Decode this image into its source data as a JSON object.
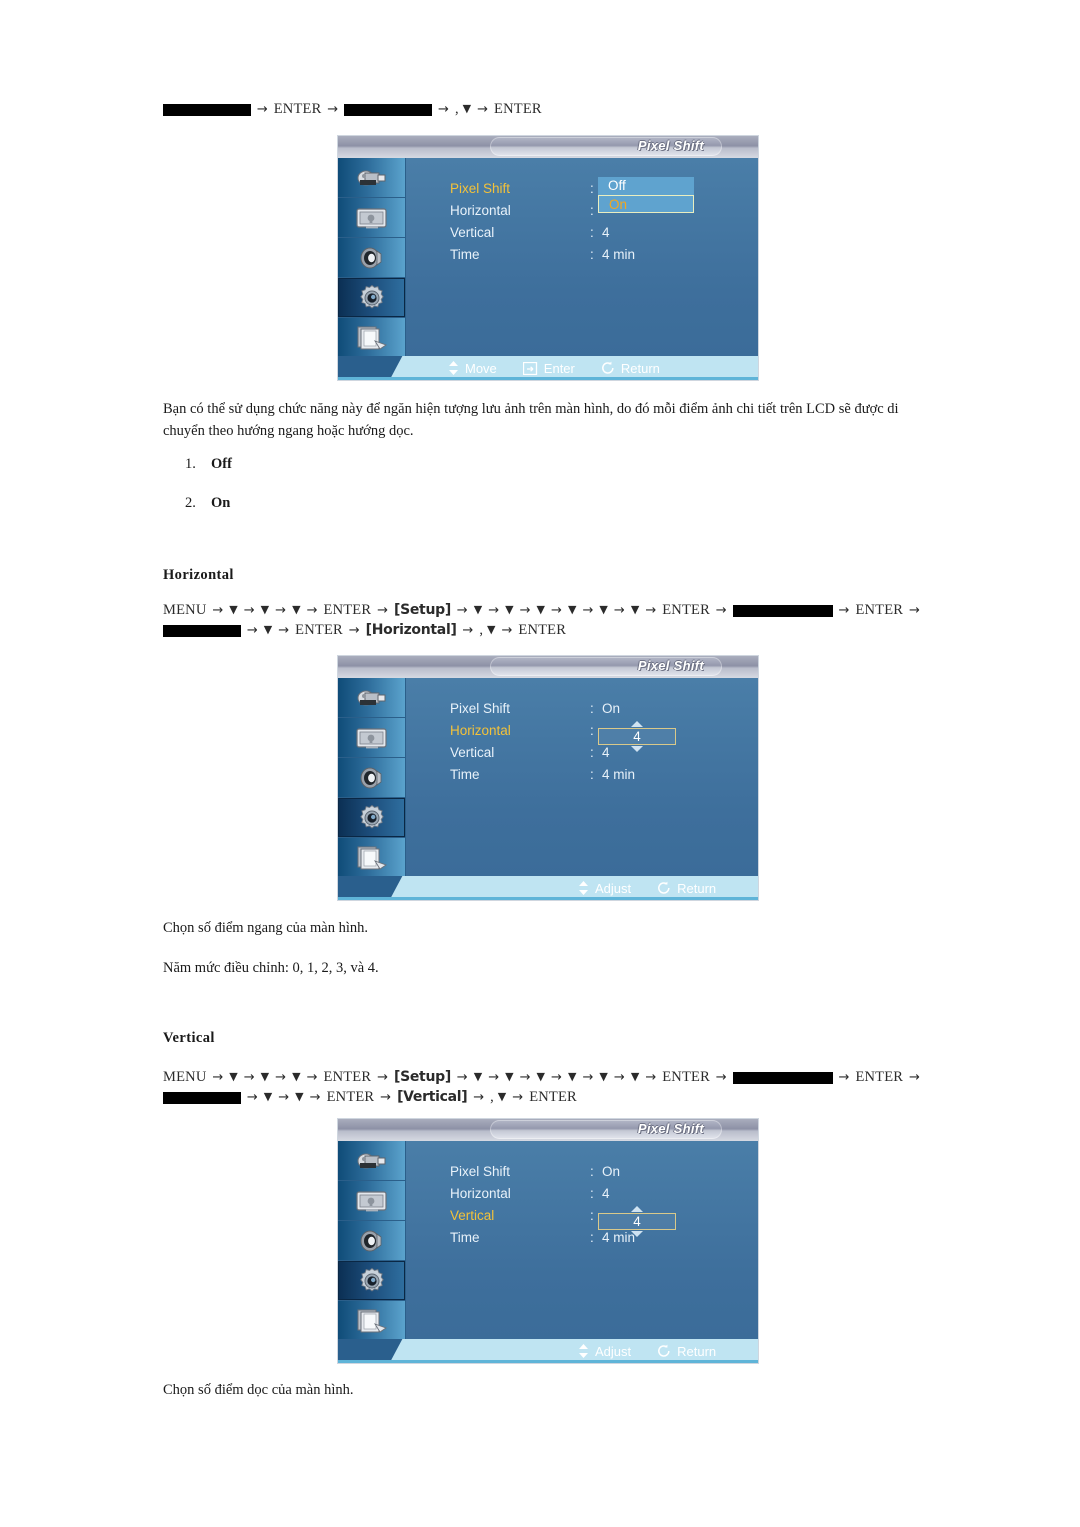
{
  "document": {
    "language": "vi",
    "title_text_color": "#1a1a1a"
  },
  "pixel_shift_section": {
    "navpath": {
      "line1": [
        {
          "type": "blackbox",
          "width": "bb-w2"
        },
        {
          "type": "arrow",
          "text": "→"
        },
        {
          "type": "text",
          "text": "ENTER"
        },
        {
          "type": "arrow",
          "text": "→"
        },
        {
          "type": "blackbox",
          "width": "bb-w2"
        },
        {
          "type": "arrow",
          "text": "→"
        },
        {
          "type": "text",
          "text": ","
        },
        {
          "type": "down",
          "text": "▼"
        },
        {
          "type": "arrow",
          "text": "→"
        },
        {
          "type": "text",
          "text": "ENTER"
        }
      ]
    },
    "osd": {
      "title": "Pixel Shift",
      "rows": [
        {
          "label": "Pixel Shift",
          "colon": ":",
          "value": "",
          "selected": true,
          "control": "dropdown"
        },
        {
          "label": "Horizontal",
          "colon": ":",
          "value": "",
          "selected": false,
          "control": "none"
        },
        {
          "label": "Vertical",
          "colon": ":",
          "value": "4",
          "selected": false,
          "control": "none"
        },
        {
          "label": "Time",
          "colon": ":",
          "value": "4 min",
          "selected": false,
          "control": "none"
        }
      ],
      "dropdown": {
        "options": [
          "Off",
          "On"
        ],
        "highlighted_index": 1
      },
      "footer": [
        {
          "icon": "updown-arrow-icon",
          "label": "Move"
        },
        {
          "icon": "enter-key-icon",
          "label": "Enter"
        },
        {
          "icon": "return-arrow-icon",
          "label": "Return"
        }
      ]
    },
    "description": "Bạn có thể sử dụng chức năng này để ngăn hiện tượng lưu ảnh trên màn hình, do đó mỗi điểm ảnh chi tiết trên LCD sẽ được di chuyển theo hướng ngang hoặc hướng dọc.",
    "options_list": [
      {
        "num": "1.",
        "value": "Off"
      },
      {
        "num": "2.",
        "value": "On"
      }
    ]
  },
  "horizontal_section": {
    "heading": "Horizontal",
    "navpath": {
      "line1": [
        {
          "type": "text",
          "text": "MENU"
        },
        {
          "type": "arrow",
          "text": "→"
        },
        {
          "type": "down",
          "text": "▼"
        },
        {
          "type": "arrow",
          "text": "→"
        },
        {
          "type": "down",
          "text": "▼"
        },
        {
          "type": "arrow",
          "text": "→"
        },
        {
          "type": "down",
          "text": "▼"
        },
        {
          "type": "arrow",
          "text": "→"
        },
        {
          "type": "text",
          "text": "ENTER"
        },
        {
          "type": "arrow",
          "text": "→"
        },
        {
          "type": "bracket",
          "text": "[Setup]"
        },
        {
          "type": "arrow",
          "text": "→"
        },
        {
          "type": "down",
          "text": "▼"
        },
        {
          "type": "arrow",
          "text": "→"
        },
        {
          "type": "down",
          "text": "▼"
        },
        {
          "type": "arrow",
          "text": "→"
        },
        {
          "type": "down",
          "text": "▼"
        },
        {
          "type": "arrow",
          "text": "→"
        },
        {
          "type": "down",
          "text": "▼"
        },
        {
          "type": "arrow",
          "text": "→"
        },
        {
          "type": "down",
          "text": "▼"
        },
        {
          "type": "arrow",
          "text": "→"
        },
        {
          "type": "down",
          "text": "▼"
        },
        {
          "type": "arrow",
          "text": "→"
        },
        {
          "type": "text",
          "text": "ENTER"
        },
        {
          "type": "arrow",
          "text": "→"
        },
        {
          "type": "blackbox",
          "width": "bb-w3"
        },
        {
          "type": "arrow",
          "text": "→"
        },
        {
          "type": "text",
          "text": "ENTER"
        },
        {
          "type": "arrow",
          "text": "→"
        }
      ],
      "line2": [
        {
          "type": "blackbox",
          "width": "bb-w1"
        },
        {
          "type": "arrow",
          "text": "→"
        },
        {
          "type": "down",
          "text": "▼"
        },
        {
          "type": "arrow",
          "text": "→"
        },
        {
          "type": "text",
          "text": "ENTER"
        },
        {
          "type": "arrow",
          "text": "→"
        },
        {
          "type": "bracket",
          "text": "[Horizontal]"
        },
        {
          "type": "arrow",
          "text": "→"
        },
        {
          "type": "text",
          "text": ","
        },
        {
          "type": "down",
          "text": "▼"
        },
        {
          "type": "arrow",
          "text": "→"
        },
        {
          "type": "text",
          "text": "ENTER"
        }
      ]
    },
    "osd": {
      "title": "Pixel Shift",
      "rows": [
        {
          "label": "Pixel Shift",
          "colon": ":",
          "value": "On",
          "selected": false,
          "control": "none"
        },
        {
          "label": "Horizontal",
          "colon": ":",
          "value": "",
          "selected": true,
          "control": "spinner"
        },
        {
          "label": "Vertical",
          "colon": ":",
          "value": "4",
          "selected": false,
          "control": "none"
        },
        {
          "label": "Time",
          "colon": ":",
          "value": "4 min",
          "selected": false,
          "control": "none"
        }
      ],
      "spinner": {
        "value": "4"
      },
      "footer": [
        {
          "icon": "updown-arrow-icon",
          "label": "Adjust"
        },
        {
          "icon": "return-arrow-icon",
          "label": "Return"
        }
      ]
    },
    "description": "Chọn số điểm ngang của màn hình.",
    "note": "Năm mức điều chỉnh: 0, 1, 2, 3, và 4."
  },
  "vertical_section": {
    "heading": "Vertical",
    "navpath": {
      "line1": [
        {
          "type": "text",
          "text": "MENU"
        },
        {
          "type": "arrow",
          "text": "→"
        },
        {
          "type": "down",
          "text": "▼"
        },
        {
          "type": "arrow",
          "text": "→"
        },
        {
          "type": "down",
          "text": "▼"
        },
        {
          "type": "arrow",
          "text": "→"
        },
        {
          "type": "down",
          "text": "▼"
        },
        {
          "type": "arrow",
          "text": "→"
        },
        {
          "type": "text",
          "text": "ENTER"
        },
        {
          "type": "arrow",
          "text": "→"
        },
        {
          "type": "bracket",
          "text": "[Setup]"
        },
        {
          "type": "arrow",
          "text": "→"
        },
        {
          "type": "down",
          "text": "▼"
        },
        {
          "type": "arrow",
          "text": "→"
        },
        {
          "type": "down",
          "text": "▼"
        },
        {
          "type": "arrow",
          "text": "→"
        },
        {
          "type": "down",
          "text": "▼"
        },
        {
          "type": "arrow",
          "text": "→"
        },
        {
          "type": "down",
          "text": "▼"
        },
        {
          "type": "arrow",
          "text": "→"
        },
        {
          "type": "down",
          "text": "▼"
        },
        {
          "type": "arrow",
          "text": "→"
        },
        {
          "type": "down",
          "text": "▼"
        },
        {
          "type": "arrow",
          "text": "→"
        },
        {
          "type": "text",
          "text": "ENTER"
        },
        {
          "type": "arrow",
          "text": "→"
        },
        {
          "type": "blackbox",
          "width": "bb-w3"
        },
        {
          "type": "arrow",
          "text": "→"
        },
        {
          "type": "text",
          "text": "ENTER"
        },
        {
          "type": "arrow",
          "text": "→"
        }
      ],
      "line2": [
        {
          "type": "blackbox",
          "width": "bb-w1"
        },
        {
          "type": "arrow",
          "text": "→"
        },
        {
          "type": "down",
          "text": "▼"
        },
        {
          "type": "arrow",
          "text": "→"
        },
        {
          "type": "down",
          "text": "▼"
        },
        {
          "type": "arrow",
          "text": "→"
        },
        {
          "type": "text",
          "text": "ENTER"
        },
        {
          "type": "arrow",
          "text": "→"
        },
        {
          "type": "bracket",
          "text": "[Vertical]"
        },
        {
          "type": "arrow",
          "text": "→"
        },
        {
          "type": "text",
          "text": ","
        },
        {
          "type": "down",
          "text": "▼"
        },
        {
          "type": "arrow",
          "text": "→"
        },
        {
          "type": "text",
          "text": "ENTER"
        }
      ]
    },
    "osd": {
      "title": "Pixel Shift",
      "rows": [
        {
          "label": "Pixel Shift",
          "colon": ":",
          "value": "On",
          "selected": false,
          "control": "none"
        },
        {
          "label": "Horizontal",
          "colon": ":",
          "value": "4",
          "selected": false,
          "control": "none"
        },
        {
          "label": "Vertical",
          "colon": ":",
          "value": "",
          "selected": true,
          "control": "spinner"
        },
        {
          "label": "Time",
          "colon": ":",
          "value": "4 min",
          "selected": false,
          "control": "none"
        }
      ],
      "spinner": {
        "value": "4"
      },
      "footer": [
        {
          "icon": "updown-arrow-icon",
          "label": "Adjust"
        },
        {
          "icon": "return-arrow-icon",
          "label": "Return"
        }
      ]
    },
    "description": "Chọn số điểm dọc của màn hình."
  },
  "sidebar_icons": [
    "input-source-icon",
    "picture-screen-icon",
    "sound-speaker-icon",
    "setup-gear-icon",
    "multi-control-icon"
  ]
}
